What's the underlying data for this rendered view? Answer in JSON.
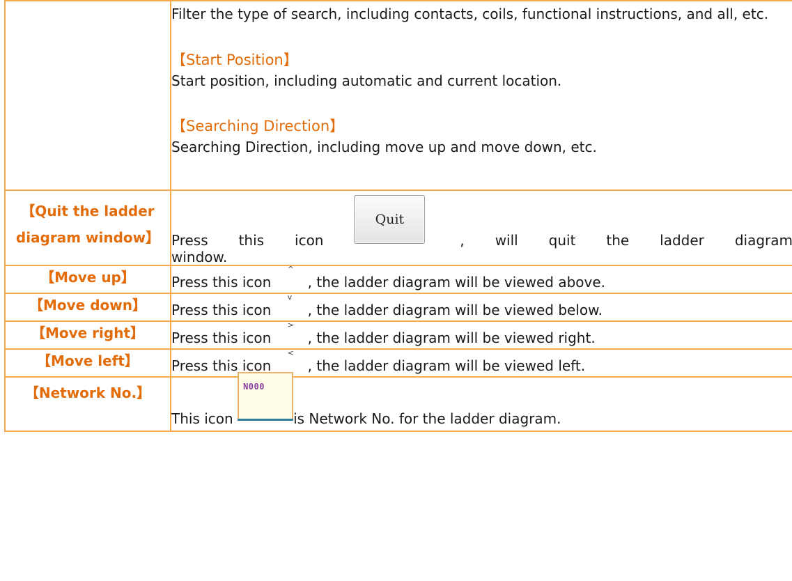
{
  "search_section": {
    "filter_text": "Filter the type of search, including contacts, coils, functional instructions, and all, etc.",
    "start_position_heading": "【Start Position】",
    "start_position_text": "Start position, including automatic and current location.",
    "searching_direction_heading": "【Searching Direction】",
    "searching_direction_text": "Searching Direction, including move up and move down, etc."
  },
  "rows": [
    {
      "label_line1": "【Quit the ladder",
      "label_line2": "diagram window】",
      "text_before": "Press this icon ",
      "icon_label": "Quit",
      "text_after": ", will quit the ladder diagram",
      "text_line2": "window."
    },
    {
      "label": "【Move up】",
      "text_before": "Press this icon ",
      "icon_glyph": "^",
      "icon_name": "up-arrow-icon",
      "text_after": ", the ladder diagram will be viewed above."
    },
    {
      "label": "【Move down】",
      "text_before": "Press this icon ",
      "icon_glyph": "v",
      "icon_name": "down-arrow-icon",
      "text_after": ", the ladder diagram will be viewed below."
    },
    {
      "label": "【Move right】",
      "text_before": "Press this icon ",
      "icon_glyph": ">",
      "icon_name": "right-arrow-icon",
      "text_after": ", the ladder diagram will be viewed right."
    },
    {
      "label": "【Move left】",
      "text_before": "Press this icon ",
      "icon_glyph": "<",
      "icon_name": "left-arrow-icon",
      "text_after": ", the ladder diagram will be viewed left."
    },
    {
      "label": "【Network No.】",
      "text_before": "This icon ",
      "icon_label": "N000",
      "text_after": "is Network No. for the ladder diagram."
    }
  ],
  "colors": {
    "accent": "#e36c0a",
    "border": "#f5a94a"
  }
}
